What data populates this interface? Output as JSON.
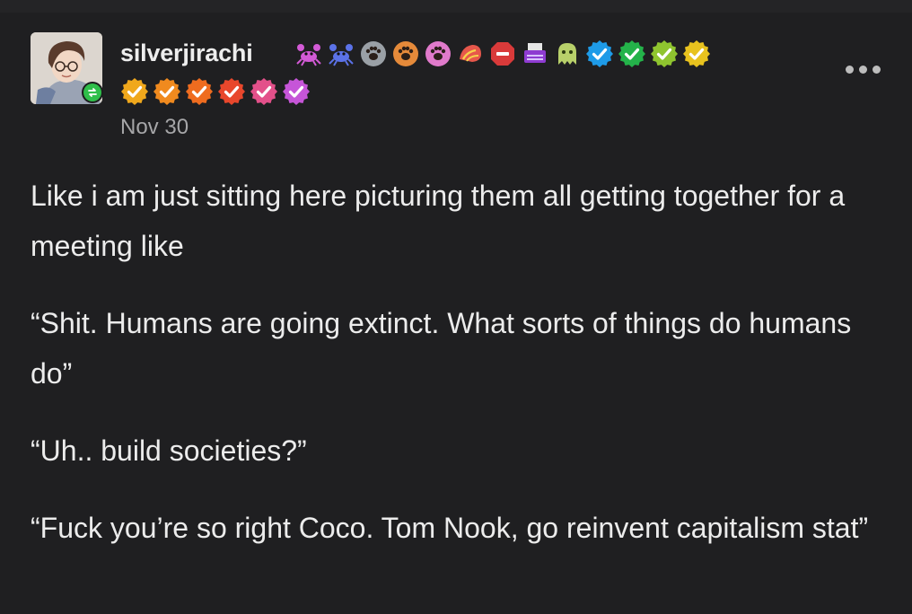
{
  "post": {
    "username": "silverjirachi",
    "date": "Nov 30",
    "paragraphs": [
      "Like i am just sitting here picturing them all getting together for a meeting like",
      "“Shit. Humans are going extinct. What sorts of things do humans do”",
      "“Uh.. build societies?”",
      "“Fuck you’re so right Coco. Tom Nook, go reinvent capitalism stat”"
    ]
  },
  "badges_row1": [
    {
      "icon": "crab-icon",
      "color": "#d35ad6"
    },
    {
      "icon": "crab-icon",
      "color": "#5b72e8"
    },
    {
      "icon": "paw-icon",
      "color": "#9aa0a6"
    },
    {
      "icon": "paw-icon",
      "color": "#e58a3a"
    },
    {
      "icon": "paw-icon",
      "color": "#e07acb"
    },
    {
      "icon": "shell-icon",
      "color": "#e6574b"
    },
    {
      "icon": "stop-badge-icon",
      "color": "#d93a3a"
    },
    {
      "icon": "typewriter-icon",
      "color": "#8e3bd1"
    },
    {
      "icon": "ghost-icon",
      "color": "#b8d06a"
    },
    {
      "icon": "verified-check-icon",
      "color": "#1e9be8"
    },
    {
      "icon": "verified-check-icon",
      "color": "#24b34a"
    },
    {
      "icon": "verified-check-icon",
      "color": "#8fc42f"
    },
    {
      "icon": "verified-check-icon",
      "color": "#e8c21e"
    }
  ],
  "badges_row2": [
    {
      "icon": "verified-check-icon",
      "color": "#f0a81c"
    },
    {
      "icon": "verified-check-icon",
      "color": "#f08a1e"
    },
    {
      "icon": "verified-check-icon",
      "color": "#ef6c1f"
    },
    {
      "icon": "verified-check-icon",
      "color": "#e8472c"
    },
    {
      "icon": "verified-check-icon",
      "color": "#e3508a"
    },
    {
      "icon": "verified-check-icon",
      "color": "#c655d8"
    }
  ]
}
